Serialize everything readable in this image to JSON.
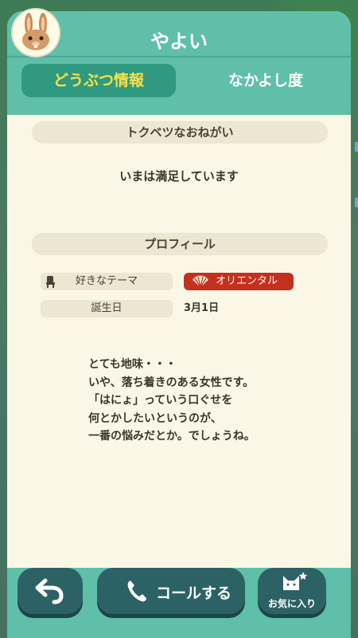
{
  "villager": {
    "name": "やよい"
  },
  "tabs": [
    {
      "label": "どうぶつ情報",
      "active": true
    },
    {
      "label": "なかよし度",
      "active": false
    }
  ],
  "special_request": {
    "heading": "トクベツなおねがい",
    "text": "いまは満足しています"
  },
  "profile": {
    "heading": "プロフィール",
    "theme_label": "好きなテーマ",
    "theme_value": "オリエンタル",
    "birthday_label": "誕生日",
    "birthday_value": "3月1日"
  },
  "bio": {
    "lines": [
      "とても地味・・・",
      "いや、落ち着きのある女性です。",
      "「はにょ」っていう口ぐせを",
      "何とかしたいというのが、",
      "一番の悩みだとか。でしょうね。"
    ]
  },
  "footer": {
    "call_label": "コールする",
    "favorite_label": "お気に入り"
  },
  "colors": {
    "header": "#5fbfa8",
    "active_tab": "#2f9a7f",
    "active_tab_text": "#f7e24a",
    "theme_badge": "#c4301f",
    "button": "#2c6266"
  },
  "icons": {
    "avatar": "rabbit-villager-avatar",
    "theme": "chair-icon",
    "theme_badge": "fan-icon",
    "back": "back-arrow-icon",
    "call": "phone-icon",
    "favorite": "cat-star-icon"
  }
}
